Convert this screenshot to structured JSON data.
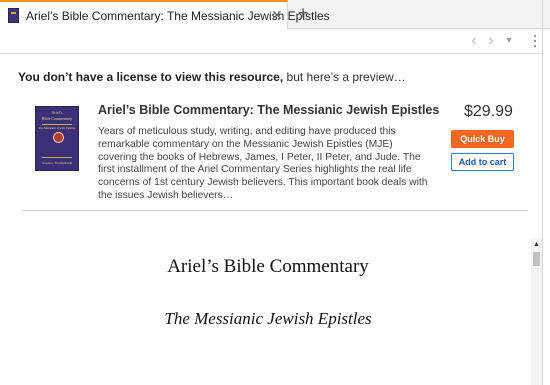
{
  "tab": {
    "title": "Ariel’s Bible Commentary: The Messianic Jewish Epistles",
    "close_glyph": "✕",
    "new_tab_glyph": "+"
  },
  "toolbar": {
    "back_glyph": "‹",
    "forward_glyph": "›",
    "dropdown_glyph": "▾"
  },
  "notice": {
    "bold": "You don’t have a license to view this resource,",
    "rest": " but here’s a preview…"
  },
  "product": {
    "title": "Ariel’s Bible Commentary: The Messianic Jewish Epistles",
    "description": "Years of meticulous study, writing, and editing have produced this remarkable commentary on the Messianic Jewish Epistles (MJE) covering the books of Hebrews, James, I Peter, II Peter, and Jude. The first installment of the Ariel Commentary Series highlights the real life concerns of 1st century Jewish believers. This important book deals with the issues Jewish believers…",
    "price": "$29.99",
    "quick_buy_label": "Quick Buy",
    "add_to_cart_label": "Add to cart"
  },
  "cover": {
    "series": "Ariel’s",
    "title": "Bible Commentary",
    "subtitle": "The Messianic Jewish Epistles",
    "author": "Arnold G. Fruchtenbaum"
  },
  "preview": {
    "heading": "Ariel’s Bible Commentary",
    "subheading": "The Messianic Jewish Epistles"
  },
  "colors": {
    "tab_accent": "#f7941d",
    "quick_buy": "#f26722",
    "add_to_cart_border": "#3a78c3",
    "cover_bg": "#3b2f78"
  },
  "icons": {
    "tab": "book-icon",
    "back": "chevron-left-icon",
    "forward": "chevron-right-icon",
    "dropdown": "caret-down-icon",
    "menu": "kebab-menu-icon",
    "scroll_up": "scroll-up-arrow-icon"
  }
}
